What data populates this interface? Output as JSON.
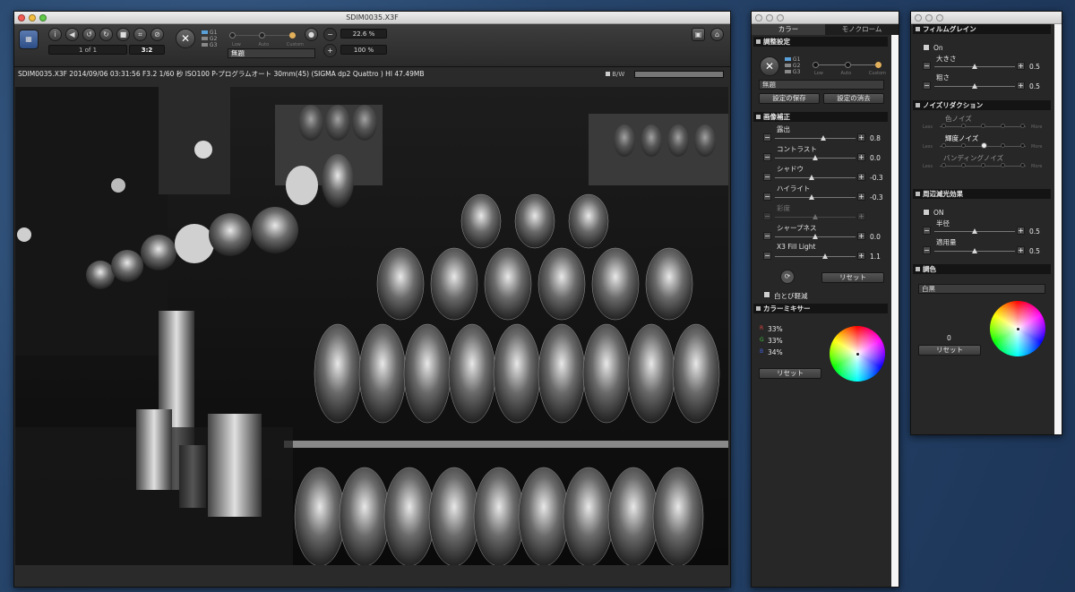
{
  "main_window": {
    "title": "SDIM0035.X3F",
    "toolbar": {
      "nav_count": "1 of 1",
      "aspect": "3:2",
      "group_labels": [
        "G1",
        "G2",
        "G3"
      ],
      "preset_value": "無題",
      "scale_labels": [
        "Low",
        "Auto",
        "Custom"
      ],
      "zoom_value": "22.6 %",
      "zoom_value2": "100 %"
    },
    "info": "SDIM0035.X3F 2014/09/06 03:31:56 F3.2 1/60 秒 ISO100 P-プログラムオート 30mm(45) (SIGMA dp2 Quattro ) HI 47.49MB",
    "bw_label": "B/W"
  },
  "color_panel": {
    "tabs": [
      "カラー",
      "モノクローム"
    ],
    "adjust": {
      "header": "調整設定",
      "groups": [
        "G1",
        "G2",
        "G3"
      ],
      "scale_labels": [
        "Low",
        "Auto",
        "Custom"
      ],
      "preset": "無題",
      "save_label": "設定の保存",
      "delete_label": "設定の消去"
    },
    "correction": {
      "header": "画像補正",
      "rows": [
        {
          "label": "露出",
          "value": "0.8",
          "level": 0.6,
          "enabled": true
        },
        {
          "label": "コントラスト",
          "value": "0.0",
          "level": 0.5,
          "enabled": true
        },
        {
          "label": "シャドウ",
          "value": "-0.3",
          "level": 0.46,
          "enabled": true
        },
        {
          "label": "ハイライト",
          "value": "-0.3",
          "level": 0.46,
          "enabled": true
        },
        {
          "label": "彩度",
          "value": "",
          "level": 0.5,
          "enabled": false
        },
        {
          "label": "シャープネス",
          "value": "0.0",
          "level": 0.5,
          "enabled": true
        },
        {
          "label": "X3 Fill Light",
          "value": "1.1",
          "level": 0.62,
          "enabled": true
        }
      ],
      "reset_label": "リセット",
      "highlight_label": "白とび軽減"
    },
    "mixer": {
      "header": "カラーミキサー",
      "channels": [
        {
          "letter": "R",
          "value": "33%",
          "color": "#e04040"
        },
        {
          "letter": "G",
          "value": "33%",
          "color": "#40c040"
        },
        {
          "letter": "B",
          "value": "34%",
          "color": "#4060e0"
        }
      ],
      "reset_label": "リセット"
    }
  },
  "mono_panel": {
    "grain": {
      "header": "フィルムグレイン",
      "on_label": "On",
      "size_label": "大きさ",
      "size_value": "0.5",
      "rough_label": "粗さ",
      "rough_value": "0.5"
    },
    "noise": {
      "header": "ノイズリダクション",
      "rows": [
        "色ノイズ",
        "輝度ノイズ",
        "バンディングノイズ"
      ],
      "low": "Less",
      "high": "More"
    },
    "vignette": {
      "header": "周辺減光効果",
      "on_label": "ON",
      "radius_label": "半径",
      "radius_value": "0.5",
      "amount_label": "適用量",
      "amount_value": "0.5"
    },
    "toning": {
      "header": "調色",
      "preset": "白黒",
      "value": "0",
      "reset_label": "リセット"
    }
  }
}
